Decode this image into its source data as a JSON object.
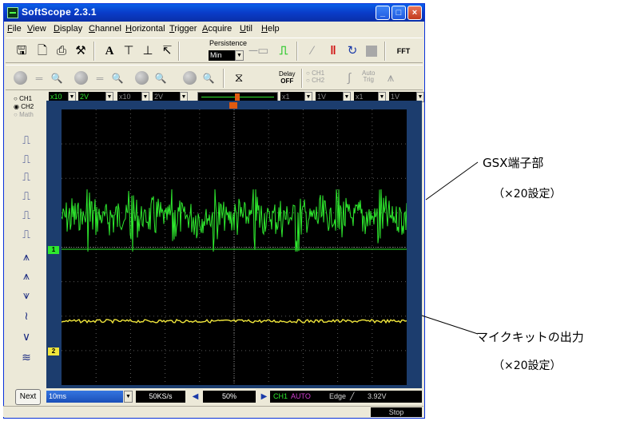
{
  "window": {
    "title": "SoftScope 2.3.1",
    "min_label": "_",
    "max_label": "□",
    "close_label": "×"
  },
  "menu": [
    "File",
    "View",
    "Display",
    "Channel",
    "Horizontal",
    "Trigger",
    "Acquire",
    "Util",
    "Help"
  ],
  "toolbar": {
    "persistence_label": "Persistence",
    "persistence_value": "Min",
    "delay_line1": "Delay",
    "delay_line2": "OFF",
    "ch_radio_1": "CH1",
    "ch_radio_2": "CH2",
    "auto_trig_1": "Auto",
    "auto_trig_2": "Trig",
    "fft_label": "FFT"
  },
  "channel_strip": {
    "ch1_probe": "x10",
    "ch1_volts": "2V",
    "ch2_probe": "x10",
    "ch2_volts": "2V",
    "math_probe": "x1",
    "math_volts": "1V",
    "ref_probe": "x1",
    "ref_volts": "1V"
  },
  "radios": {
    "ch1": "CH1",
    "ch2": "CH2",
    "math": "Math"
  },
  "markers": {
    "ch1": "1",
    "ch2": "2"
  },
  "next_label": "Next",
  "status": {
    "timebase": "10ms",
    "sample_rate": "50KS/s",
    "trigger_pos": "50%",
    "trig_source": "CH1",
    "trig_mode": "AUTO",
    "trig_type": "Edge",
    "trig_level": "3.92V",
    "run_state": "Stop"
  },
  "annotations": {
    "gsx_title": "GSX端子部",
    "gsx_sub": "（×20設定）",
    "mic_title": "マイクキットの出力",
    "mic_sub": "（×20設定）"
  },
  "colors": {
    "ch1_trace": "#2ee82e",
    "ch2_trace": "#f0e63c",
    "grid": "#5a5a5a"
  }
}
